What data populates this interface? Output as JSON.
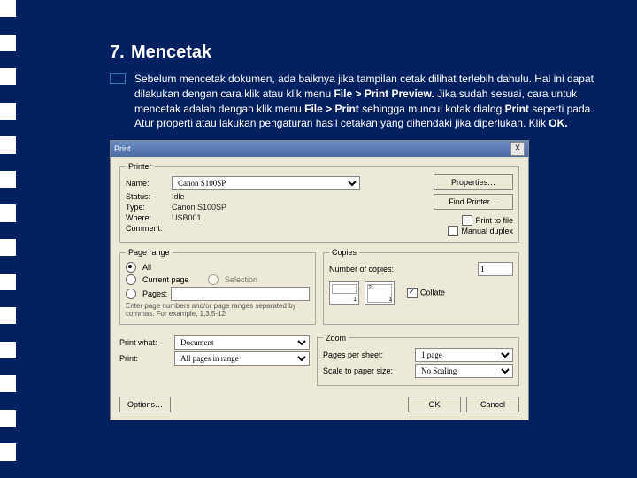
{
  "heading": {
    "num": "7.",
    "title": "Mencetak"
  },
  "para": {
    "pre": "Sebelum mencetak dokumen, ada baiknya jika tampilan cetak dilihat terlebih dahulu. Hal ini dapat dilakukan dengan cara klik atau klik menu ",
    "b1": "File > Print Preview.",
    "mid": " Jika sudah sesuai, cara untuk mencetak adalah dengan klik menu ",
    "b2": "File > Print",
    "mid2": " sehingga muncul kotak dialog ",
    "b3": "Print",
    "mid3": " seperti pada. Atur properti atau lakukan pengaturan hasil cetakan yang dihendaki jika diperlukan. Klik ",
    "b4": "OK."
  },
  "dlg": {
    "title": "Print",
    "close": "X"
  },
  "printer": {
    "legend": "Printer",
    "name_lbl": "Name:",
    "name": "Canon S100SP",
    "status_lbl": "Status:",
    "status": "Idle",
    "type_lbl": "Type:",
    "type": "Canon S100SP",
    "where_lbl": "Where:",
    "where": "USB001",
    "comment_lbl": "Comment:",
    "properties": "Properties…",
    "find": "Find Printer…",
    "tofile": "Print to file",
    "manual": "Manual duplex"
  },
  "range": {
    "legend": "Page range",
    "all": "All",
    "current": "Current page",
    "selection": "Selection",
    "pages_lbl": "Pages:",
    "hint": "Enter page numbers and/or page ranges separated by commas. For example, 1,3,5-12"
  },
  "copies": {
    "legend": "Copies",
    "num_lbl": "Number of copies:",
    "num": "1",
    "collate": "Collate"
  },
  "printwhat": {
    "lbl": "Print what:",
    "val": "Document",
    "print_lbl": "Print:",
    "print_val": "All pages in range"
  },
  "zoom": {
    "legend": "Zoom",
    "pps_lbl": "Pages per sheet:",
    "pps": "1 page",
    "scale_lbl": "Scale to paper size:",
    "scale": "No Scaling"
  },
  "foot": {
    "options": "Options…",
    "ok": "OK",
    "cancel": "Cancel"
  }
}
